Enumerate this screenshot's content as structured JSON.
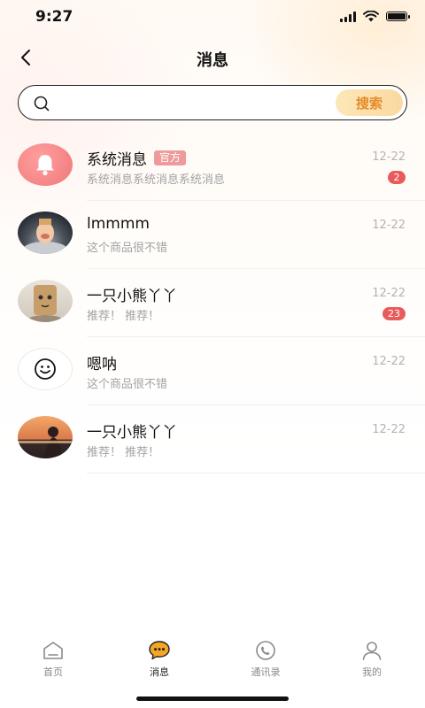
{
  "status_bar": {
    "time": "9:27"
  },
  "header": {
    "title": "消息"
  },
  "search": {
    "placeholder": "",
    "button_label": "搜索"
  },
  "conversations": [
    {
      "name": "系统消息",
      "badge": "官方",
      "preview": "系统消息系统消息系统消息",
      "time": "12-22",
      "unread": "2",
      "avatar": "bell-icon"
    },
    {
      "name": "lmmmm",
      "badge": "",
      "preview": "这个商品很不错",
      "time": "12-22",
      "unread": "",
      "avatar": "photo"
    },
    {
      "name": "一只小熊丫丫",
      "badge": "",
      "preview": "推荐！ 推荐！",
      "time": "12-22",
      "unread": "23",
      "avatar": "photo"
    },
    {
      "name": "嗯呐",
      "badge": "",
      "preview": "这个商品很不错",
      "time": "12-22",
      "unread": "",
      "avatar": "smiley-icon"
    },
    {
      "name": "一只小熊丫丫",
      "badge": "",
      "preview": "推荐！ 推荐！",
      "time": "12-22",
      "unread": "",
      "avatar": "photo"
    }
  ],
  "tabs": [
    {
      "label": "首页",
      "icon": "home-icon",
      "active": false
    },
    {
      "label": "消息",
      "icon": "chat-icon",
      "active": true
    },
    {
      "label": "通讯录",
      "icon": "phone-icon",
      "active": false
    },
    {
      "label": "我的",
      "icon": "user-icon",
      "active": false
    }
  ],
  "colors": {
    "accent": "#f5a623",
    "unread": "#e85b5b",
    "official_badge": "#ee9a9a"
  }
}
